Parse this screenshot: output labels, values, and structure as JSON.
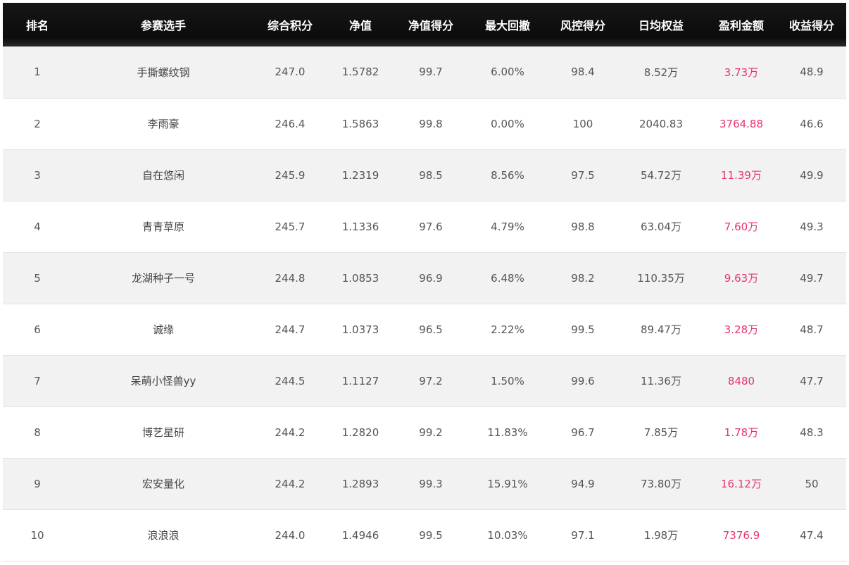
{
  "colors": {
    "header_bg": "#111111",
    "profit": "#e8336e",
    "row_alt": "#f2f2f2"
  },
  "headers": [
    "排名",
    "参赛选手",
    "综合积分",
    "净值",
    "净值得分",
    "最大回撤",
    "风控得分",
    "日均权益",
    "盈利金额",
    "收益得分"
  ],
  "rows": [
    [
      "1",
      "手撕螺纹钢",
      "247.0",
      "1.5782",
      "99.7",
      "6.00%",
      "98.4",
      "8.52万",
      "3.73万",
      "48.9"
    ],
    [
      "2",
      "李雨豪",
      "246.4",
      "1.5863",
      "99.8",
      "0.00%",
      "100",
      "2040.83",
      "3764.88",
      "46.6"
    ],
    [
      "3",
      "自在悠闲",
      "245.9",
      "1.2319",
      "98.5",
      "8.56%",
      "97.5",
      "54.72万",
      "11.39万",
      "49.9"
    ],
    [
      "4",
      "青青草原",
      "245.7",
      "1.1336",
      "97.6",
      "4.79%",
      "98.8",
      "63.04万",
      "7.60万",
      "49.3"
    ],
    [
      "5",
      "龙湖种子一号",
      "244.8",
      "1.0853",
      "96.9",
      "6.48%",
      "98.2",
      "110.35万",
      "9.63万",
      "49.7"
    ],
    [
      "6",
      "诚缘",
      "244.7",
      "1.0373",
      "96.5",
      "2.22%",
      "99.5",
      "89.47万",
      "3.28万",
      "48.7"
    ],
    [
      "7",
      "呆萌小怪兽yy",
      "244.5",
      "1.1127",
      "97.2",
      "1.50%",
      "99.6",
      "11.36万",
      "8480",
      "47.7"
    ],
    [
      "8",
      "博艺星研",
      "244.2",
      "1.2820",
      "99.2",
      "11.83%",
      "96.7",
      "7.85万",
      "1.78万",
      "48.3"
    ],
    [
      "9",
      "宏安量化",
      "244.2",
      "1.2893",
      "99.3",
      "15.91%",
      "94.9",
      "73.80万",
      "16.12万",
      "50"
    ],
    [
      "10",
      "浪浪浪",
      "244.0",
      "1.4946",
      "99.5",
      "10.03%",
      "97.1",
      "1.98万",
      "7376.9",
      "47.4"
    ]
  ]
}
